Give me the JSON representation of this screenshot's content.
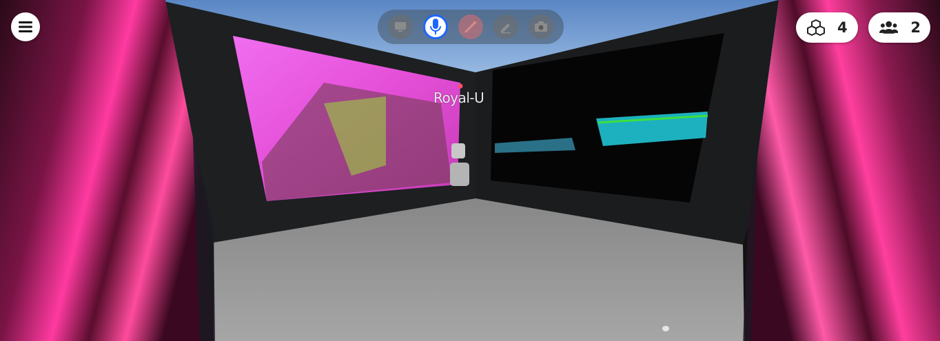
{
  "menu": {
    "icon": "hamburger-menu-icon"
  },
  "toolbar": {
    "tools": [
      {
        "name": "screen-share",
        "icon": "monitor-icon",
        "active": false
      },
      {
        "name": "microphone",
        "icon": "microphone-icon",
        "active": true
      },
      {
        "name": "reactions",
        "icon": "magic-wand-icon",
        "active": false
      },
      {
        "name": "draw",
        "icon": "pencil-icon",
        "active": false
      },
      {
        "name": "camera",
        "icon": "camera-icon",
        "active": false
      }
    ]
  },
  "objects_counter": {
    "icon": "cubes-icon",
    "count": "4"
  },
  "people_counter": {
    "icon": "users-icon",
    "count": "2"
  },
  "avatar": {
    "name": "Royal-U"
  },
  "colors": {
    "active_tool_border": "#1e66ff",
    "toolbar_bg": "rgba(70,85,100,0.55)",
    "sky": "#6f9ad0",
    "floor": "#9a9a9a",
    "wall": "#1c1e20"
  }
}
